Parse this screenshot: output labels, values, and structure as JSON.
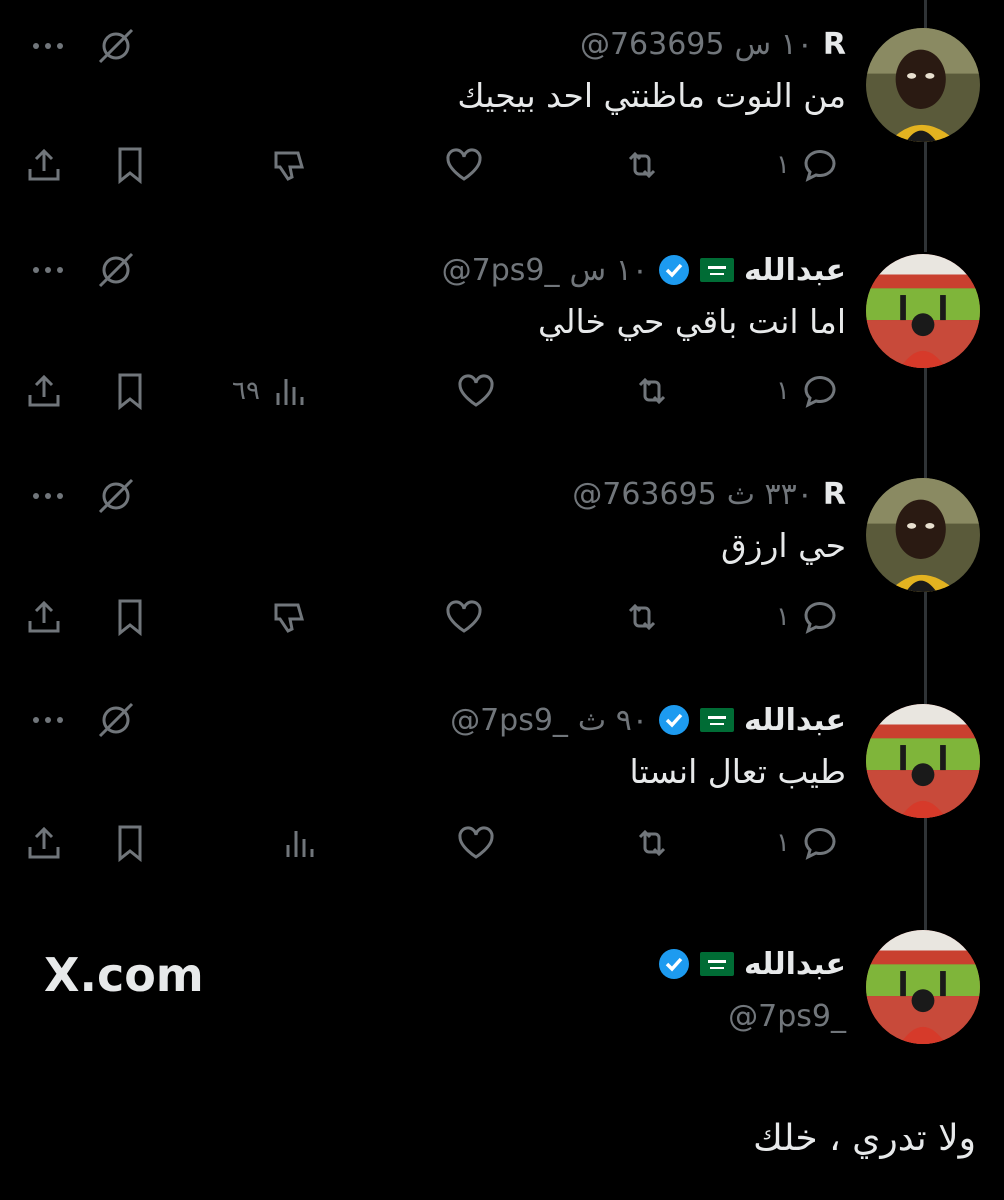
{
  "tweets": [
    {
      "name": "R",
      "handle": "@763695",
      "time": "١٠ س",
      "text": "من النوت ماظنتي احد بيجيك",
      "avatar": "player-avatar",
      "verified": false,
      "reply_count": "١",
      "views_label": ""
    },
    {
      "name": "عبدالله",
      "handle": "@7ps9_",
      "time": "١٠ س",
      "text": "اما انت باقي حي خالي",
      "avatar": "stadium-fan-avatar",
      "verified": true,
      "reply_count": "١",
      "views_label": "٦٩"
    },
    {
      "name": "R",
      "handle": "@763695",
      "time": "٣٣٠ ث",
      "text": "حي ارزق",
      "avatar": "player-avatar",
      "verified": false,
      "reply_count": "١",
      "views_label": ""
    },
    {
      "name": "عبدالله",
      "handle": "@7ps9_",
      "time": "٩٠ ث",
      "text": "طيب تعال انستا",
      "avatar": "stadium-fan-avatar",
      "verified": true,
      "reply_count": "١",
      "views_label": ""
    }
  ],
  "footer": {
    "brand": "X.com",
    "name": "عبدالله",
    "handle": "@7ps9_"
  },
  "caption": "ولا تدري ، خلك",
  "colors": {
    "background": "#000000",
    "text": "#e7e9ea",
    "muted": "#71767b",
    "verified": "#1d9bf0",
    "flag": "#006c35"
  }
}
